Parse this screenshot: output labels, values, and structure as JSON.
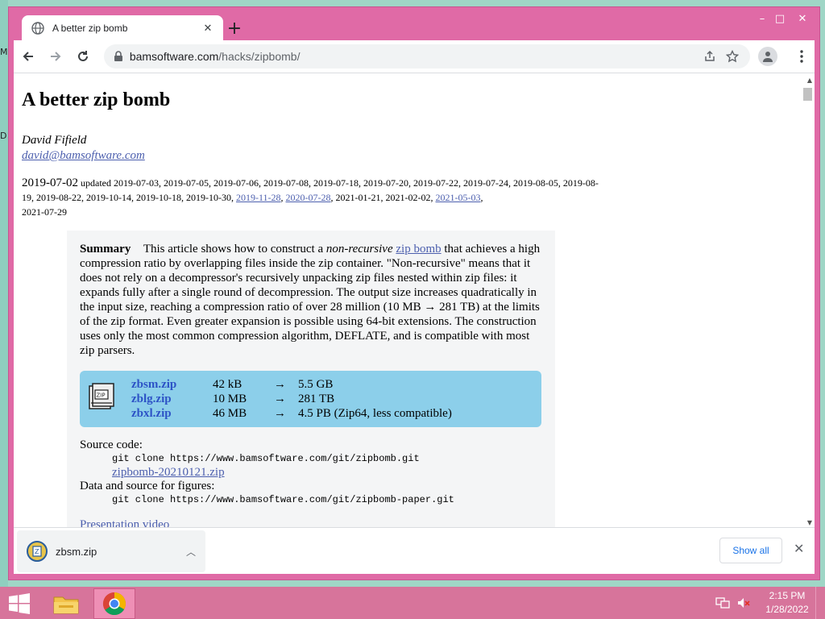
{
  "desktop": {
    "marks": [
      "M",
      "D"
    ]
  },
  "window": {
    "controls": {
      "minimize": "–",
      "maximize": "□",
      "close": "✕"
    }
  },
  "tab": {
    "title": "A better zip bomb",
    "close": "✕",
    "new_tab": "+"
  },
  "toolbar": {
    "url_host": "bamsoftware.com",
    "url_path": "/hacks/zipbomb/",
    "icons": [
      "back-icon",
      "forward-icon",
      "reload-icon",
      "lock-icon",
      "share-icon",
      "star-icon",
      "profile-icon",
      "menu-icon"
    ]
  },
  "page": {
    "title": "A better zip bomb",
    "author": "David Fifield",
    "email": "david@bamsoftware.com",
    "date": "2019-07-02",
    "updated_label": "updated",
    "updated_plain_1": "2019-07-03, 2019-07-05, 2019-07-06, 2019-07-08, 2019-07-18, 2019-07-20, 2019-07-22, 2019-07-24, 2019-08-05, 2019-08-19, 2019-08-22, 2019-10-14, 2019-10-18, 2019-10-30,",
    "updated_link_1": "2019-11-28",
    "updated_link_2": "2020-07-28",
    "updated_plain_2": ", 2021-01-21, 2021-02-02,",
    "updated_link_3": "2021-05-03",
    "updated_plain_3": ",",
    "updated_last": "2021-07-29",
    "summary": {
      "label": "Summary",
      "text_a": "This article shows how to construct a",
      "em": "non-recursive",
      "link": "zip bomb",
      "text_b": "that achieves a high compression ratio by overlapping files inside the zip container. \"Non-recursive\" means that it does not rely on a decompressor's recursively unpacking zip files nested within zip files: it expands fully after a single round of decompression. The output size increases quadratically in the input size, reaching a compression ratio of over 28 million (10 MB → 281 TB) at the limits of the zip format. Even greater expansion is possible using 64-bit extensions. The construction uses only the most common compression algorithm, DEFLATE, and is compatible with most zip parsers."
    },
    "downloads": [
      {
        "name": "zbsm.zip",
        "size": "42 kB",
        "arrow": "→",
        "result": "5.5 GB"
      },
      {
        "name": "zblg.zip",
        "size": "10 MB",
        "arrow": "→",
        "result": "281 TB"
      },
      {
        "name": "zbxl.zip",
        "size": "46 MB",
        "arrow": "→",
        "result": "4.5 PB (Zip64, less compatible)"
      }
    ],
    "source_label": "Source code:",
    "source_git": "git clone https://www.bamsoftware.com/git/zipbomb.git",
    "source_link": "zipbomb-20210121.zip",
    "figures_label": "Data and source for figures:",
    "figures_git": "git clone https://www.bamsoftware.com/git/zipbomb-paper.git",
    "presentation_link": "Presentation video"
  },
  "download_shelf": {
    "file_name": "zbsm.zip",
    "show_all": "Show all",
    "close": "✕"
  },
  "taskbar": {
    "time": "2:15 PM",
    "date": "1/28/2022"
  }
}
